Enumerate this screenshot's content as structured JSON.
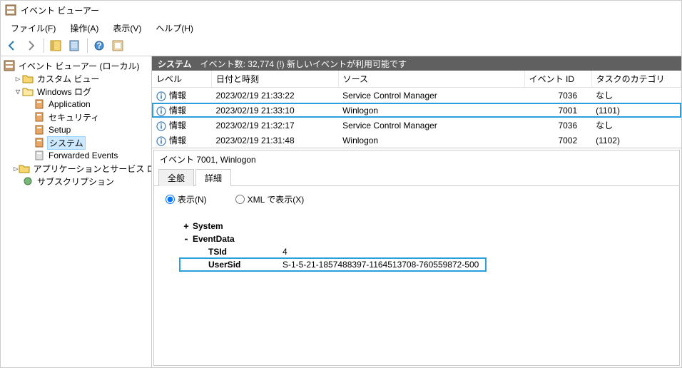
{
  "window": {
    "title": "イベント ビューアー"
  },
  "menu": {
    "file": "ファイル(F)",
    "action": "操作(A)",
    "view": "表示(V)",
    "help": "ヘルプ(H)"
  },
  "tree": {
    "root": "イベント ビューアー (ローカル)",
    "custom": "カスタム ビュー",
    "windows": "Windows ログ",
    "app": "Application",
    "sec": "セキュリティ",
    "setup": "Setup",
    "system": "システム",
    "fwd": "Forwarded Events",
    "appsvc": "アプリケーションとサービス ログ",
    "subs": "サブスクリプション"
  },
  "header": {
    "section": "システム",
    "count": "イベント数: 32,774 (!) 新しいイベントが利用可能です"
  },
  "cols": {
    "level": "レベル",
    "dt": "日付と時刻",
    "src": "ソース",
    "id": "イベント ID",
    "cat": "タスクのカテゴリ"
  },
  "rows": [
    {
      "level": "情報",
      "dt": "2023/02/19 21:33:22",
      "src": "Service Control Manager",
      "id": "7036",
      "cat": "なし",
      "hl": false
    },
    {
      "level": "情報",
      "dt": "2023/02/19 21:33:10",
      "src": "Winlogon",
      "id": "7001",
      "cat": "(1101)",
      "hl": true
    },
    {
      "level": "情報",
      "dt": "2023/02/19 21:32:17",
      "src": "Service Control Manager",
      "id": "7036",
      "cat": "なし",
      "hl": false
    },
    {
      "level": "情報",
      "dt": "2023/02/19 21:31:48",
      "src": "Winlogon",
      "id": "7002",
      "cat": "(1102)",
      "hl": false
    }
  ],
  "detail": {
    "title": "イベント 7001, Winlogon",
    "tab_general": "全般",
    "tab_detail": "詳細",
    "radio_friendly": "表示(N)",
    "radio_xml": "XML で表示(X)",
    "system_node": "System",
    "eventdata_node": "EventData",
    "tsid_key": "TSId",
    "tsid_val": "4",
    "usersid_key": "UserSid",
    "usersid_val": "S-1-5-21-1857488397-1164513708-760559872-500"
  }
}
